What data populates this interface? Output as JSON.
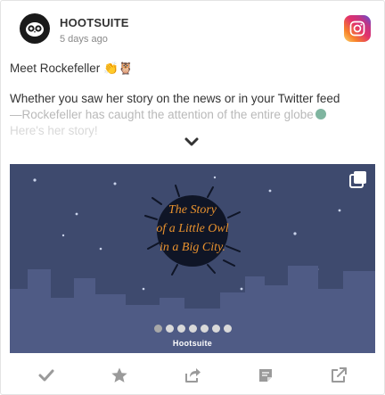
{
  "header": {
    "brand_name": "HOOTSUITE",
    "timestamp": "5 days ago",
    "network_icon": "instagram-icon"
  },
  "post": {
    "title": "Meet Rockefeller 👏🦉",
    "body_line1": "Whether you saw her story on the news or in your Twitter feed",
    "body_line2": "—Rockefeller has caught the attention of the entire globe",
    "body_line3": "Here's her story!"
  },
  "media": {
    "headline_line1": "The Story",
    "headline_line2": "of a Little Owl",
    "headline_line3": "in a Big City.",
    "brand_text": "Hootsuite",
    "slide_count": 7,
    "active_slide": 1,
    "colors": {
      "sky": "#3e4a6e",
      "city": "#4f5b85",
      "title": "#e8912e"
    }
  },
  "actions": [
    {
      "name": "approve",
      "icon": "checkmark-icon"
    },
    {
      "name": "favorite",
      "icon": "star-icon"
    },
    {
      "name": "share",
      "icon": "share-icon"
    },
    {
      "name": "note",
      "icon": "note-icon"
    },
    {
      "name": "open",
      "icon": "external-link-icon"
    }
  ]
}
